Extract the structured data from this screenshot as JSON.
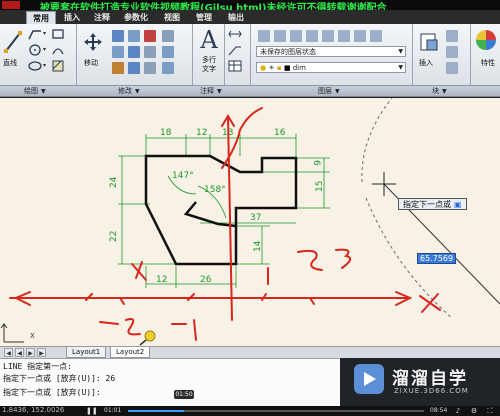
{
  "window": {
    "title": "被要套在软件打造专业软件视频教程(Gilsu html)未经许可不得转载谢谢配合"
  },
  "ribbon": {
    "tabs": [
      "常用",
      "插入",
      "注释",
      "参数化",
      "视图",
      "管理",
      "输出"
    ],
    "active_tab": "常用",
    "groups": {
      "draw": {
        "label": "绘图",
        "line_label": "直线"
      },
      "modify": {
        "label": "修改",
        "move_label": "移动"
      },
      "annotation": {
        "label": "注释",
        "text_label": "多行",
        "text_label2": "文字"
      },
      "layers": {
        "label": "图层",
        "layer_state": "未保存的图层状态",
        "current_layer": "dim"
      },
      "block": {
        "label": "块",
        "insert_label": "插入"
      },
      "properties": {
        "label": "特性"
      }
    }
  },
  "drawing": {
    "dimensions": {
      "top": [
        "18",
        "12",
        "13",
        "16"
      ],
      "left": [
        "24",
        "22"
      ],
      "right": [
        "6",
        "15",
        "14"
      ],
      "middle_width": "37",
      "bottom": [
        "12",
        "26"
      ],
      "angles": [
        "147°",
        "158°"
      ]
    },
    "dynamic_input": {
      "prompt": "指定下一点或",
      "value": "65.7569"
    },
    "handwriting": [
      "2",
      "3",
      "1",
      "-2",
      "1"
    ]
  },
  "layout_tabs": [
    "Layout1",
    "Layout2"
  ],
  "command_line": {
    "lines": [
      "LINE 指定第一点:",
      "指定下一点或 [放弃(U)]: 26",
      "指定下一点或 [放弃(U)]:"
    ],
    "coordinates": "1.8436, 152.0026"
  },
  "watermark": {
    "name": "溜溜自学",
    "url": "ZIXUE.3D66.COM"
  },
  "player": {
    "current_time": "01:01",
    "hover_time": "01:50",
    "total_time": "08:54",
    "progress": 0.19,
    "colors": {
      "accent": "#3aa0ff",
      "annotation": "#d9261c",
      "dimension": "#1a9a2a"
    }
  }
}
